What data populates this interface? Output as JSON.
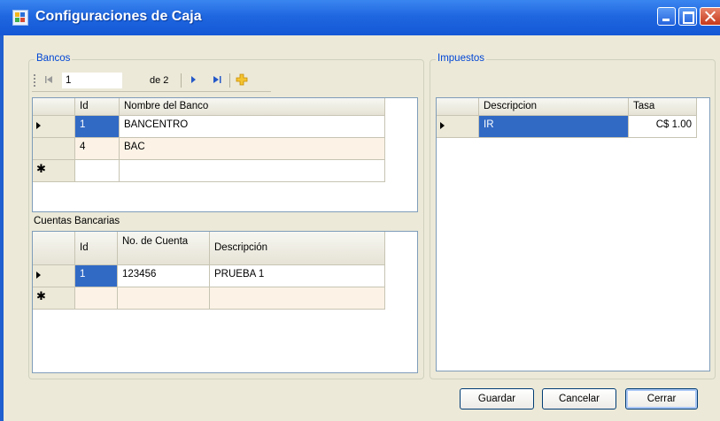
{
  "window": {
    "title": "Configuraciones de Caja"
  },
  "bancos": {
    "label": "Bancos",
    "navigator": {
      "position": "1",
      "of_label": "de 2"
    },
    "columns": [
      "Id",
      "Nombre del Banco"
    ],
    "rows": [
      {
        "id": "1",
        "nombre": "BANCENTRO"
      },
      {
        "id": "4",
        "nombre": "BAC"
      }
    ]
  },
  "cuentas": {
    "label": "Cuentas Bancarias",
    "columns": [
      "Id",
      "No. de Cuenta",
      "Descripción"
    ],
    "rows": [
      {
        "id": "1",
        "numero": "123456",
        "descripcion": "PRUEBA 1"
      }
    ]
  },
  "impuestos": {
    "label": "Impuestos",
    "columns": [
      "Descripcion",
      "Tasa"
    ],
    "rows": [
      {
        "descripcion": "IR",
        "tasa": "C$ 1.00"
      }
    ]
  },
  "buttons": {
    "guardar": "Guardar",
    "cancelar": "Cancelar",
    "cerrar": "Cerrar"
  },
  "colors": {
    "title_bar": "#1f67e0",
    "selection": "#316ac5",
    "group_label": "#0046d5"
  }
}
